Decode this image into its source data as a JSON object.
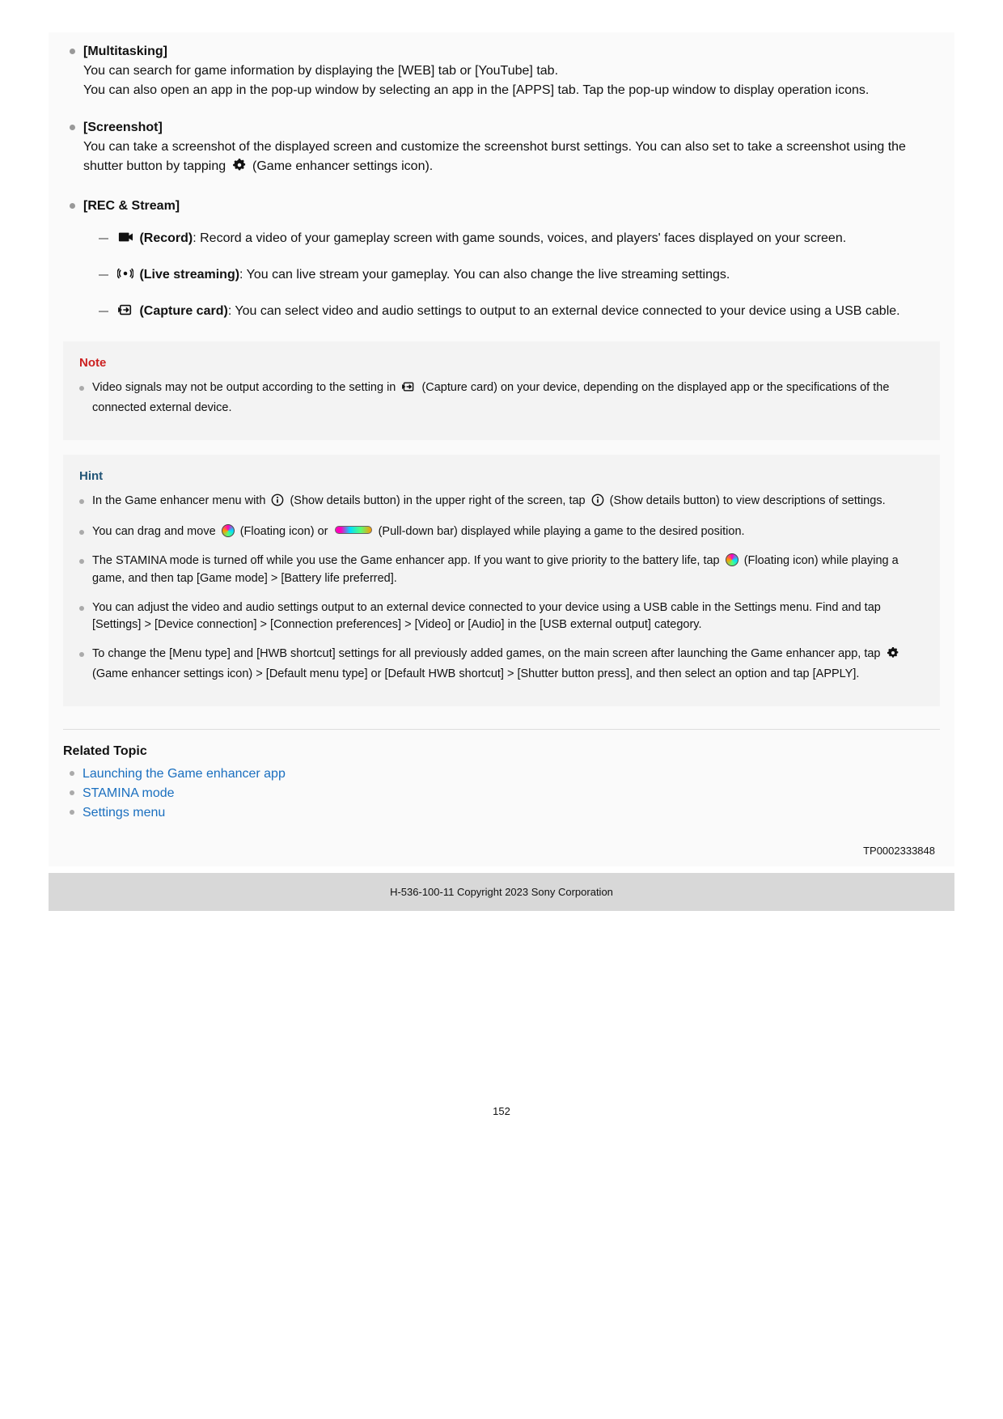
{
  "sections": {
    "multitasking": {
      "title": "[Multitasking]",
      "p1": "You can search for game information by displaying the [WEB] tab or [YouTube] tab.",
      "p2": "You can also open an app in the pop-up window by selecting an app in the [APPS] tab. Tap the pop-up window to display operation icons."
    },
    "screenshot": {
      "title": "[Screenshot]",
      "t1": "You can take a screenshot of the displayed screen and customize the screenshot burst settings. You can also set to take a screenshot using the shutter button by tapping ",
      "t2": " (Game enhancer settings icon)."
    },
    "rec": {
      "title": "[REC & Stream]",
      "record_label": " (Record)",
      "record_text": ": Record a video of your gameplay screen with game sounds, voices, and players' faces displayed on your screen.",
      "live_label": " (Live streaming)",
      "live_text": ": You can live stream your gameplay. You can also change the live streaming settings.",
      "cap_label": " (Capture card)",
      "cap_text": ": You can select video and audio settings to output to an external device connected to your device using a USB cable."
    }
  },
  "note": {
    "title": "Note",
    "n1a": "Video signals may not be output according to the setting in ",
    "n1b": " (Capture card) on your device, depending on the displayed app or the specifications of the connected external device."
  },
  "hint": {
    "title": "Hint",
    "h1a": "In the Game enhancer menu with ",
    "h1b": " (Show details button) in the upper right of the screen, tap ",
    "h1c": " (Show details button) to view descriptions of settings.",
    "h2a": "You can drag and move ",
    "h2b": " (Floating icon) or ",
    "h2c": " (Pull-down bar) displayed while playing a game to the desired position.",
    "h3a": "The STAMINA mode is turned off while you use the Game enhancer app. If you want to give priority to the battery life, tap ",
    "h3b": " (Floating icon) while playing a game, and then tap [Game mode] > [Battery life preferred].",
    "h4": "You can adjust the video and audio settings output to an external device connected to your device using a USB cable in the Settings menu. Find and tap [Settings] > [Device connection] > [Connection preferences] > [Video] or [Audio] in the [USB external output] category.",
    "h5a": "To change the [Menu type] and [HWB shortcut] settings for all previously added games, on the main screen after launching the Game enhancer app, tap ",
    "h5b": " (Game enhancer settings icon) > [Default menu type] or [Default HWB shortcut] > [Shutter button press], and then select an option and tap [APPLY]."
  },
  "related": {
    "title": "Related Topic",
    "items": [
      "Launching the Game enhancer app",
      "STAMINA mode",
      "Settings menu"
    ]
  },
  "docid": "TP0002333848",
  "copyright": "H-536-100-11 Copyright 2023 Sony Corporation",
  "page": "152"
}
